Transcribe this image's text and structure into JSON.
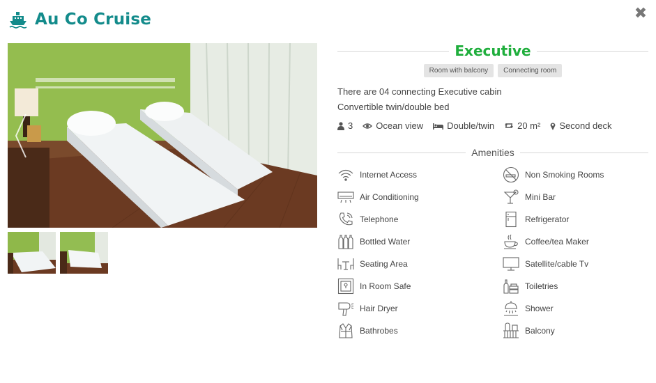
{
  "header": {
    "title": "Au Co Cruise",
    "close_symbol": "✖"
  },
  "gallery": {
    "thumbnail_count": 2
  },
  "cabin": {
    "name": "Executive",
    "tags": [
      "Room with balcony",
      "Connecting room"
    ],
    "description": [
      "There are 04 connecting Executive cabin",
      "Convertible twin/double bed"
    ],
    "specs": {
      "guests": "3",
      "view": "Ocean view",
      "bed": "Double/twin",
      "size": "20 m²",
      "deck": "Second deck"
    }
  },
  "amenities": {
    "heading": "Amenities",
    "left": [
      "Internet Access",
      "Air Conditioning",
      "Telephone",
      "Bottled Water",
      "Seating Area",
      "In Room Safe",
      "Hair Dryer",
      "Bathrobes"
    ],
    "right": [
      "Non Smoking Rooms",
      "Mini Bar",
      "Refrigerator",
      "Coffee/tea Maker",
      "Satellite/cable Tv",
      "Toiletries",
      "Shower",
      "Balcony"
    ]
  },
  "colors": {
    "brand": "#138b8b",
    "cabin_name": "#1fae3c",
    "tag_bg": "#e4e4e4"
  }
}
